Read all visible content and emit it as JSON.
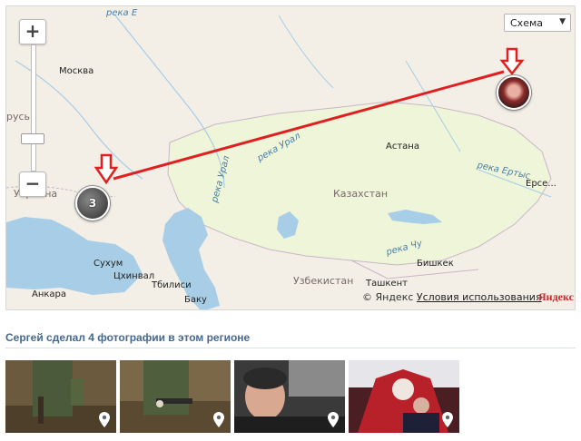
{
  "map": {
    "layer_select": {
      "value": "Схема"
    },
    "zoom": {
      "plus": "+",
      "minus": "−"
    },
    "labels": {
      "river_top": "река Е",
      "moskva": "Москва",
      "rus": "русь",
      "ukraina": "Украина",
      "astana": "Астана",
      "kazakhstan": "Казахстан",
      "river_ural1": "река Урал",
      "river_ural2": "река Урал",
      "river_irtysh": "река Ертыс",
      "river_chu": "река Чу",
      "sukhum": "Сухум",
      "tskhinval": "Цхинвал",
      "tbilisi": "Тбилиси",
      "baku": "Баку",
      "uzbekistan": "Узбекистан",
      "bishkek": "Бишкек",
      "tashkent": "Ташкент",
      "ankara": "Анкара",
      "ersekiy": "Ерсе..."
    },
    "cluster_count": "3",
    "copyright": "© Яндекс",
    "terms_link": "Условия использования",
    "logo": "Яндекс",
    "colors": {
      "land": "#f3efe6",
      "kazakhstan": "#eef5d8",
      "water": "#a8cde6",
      "route": "#e02020"
    }
  },
  "photos": {
    "heading": "Сергей сделал 4 фотографии в этом регионе",
    "items": [
      {
        "icon": "location-pin-icon"
      },
      {
        "icon": "location-pin-icon"
      },
      {
        "icon": "location-pin-icon"
      },
      {
        "icon": "location-pin-icon"
      }
    ]
  }
}
